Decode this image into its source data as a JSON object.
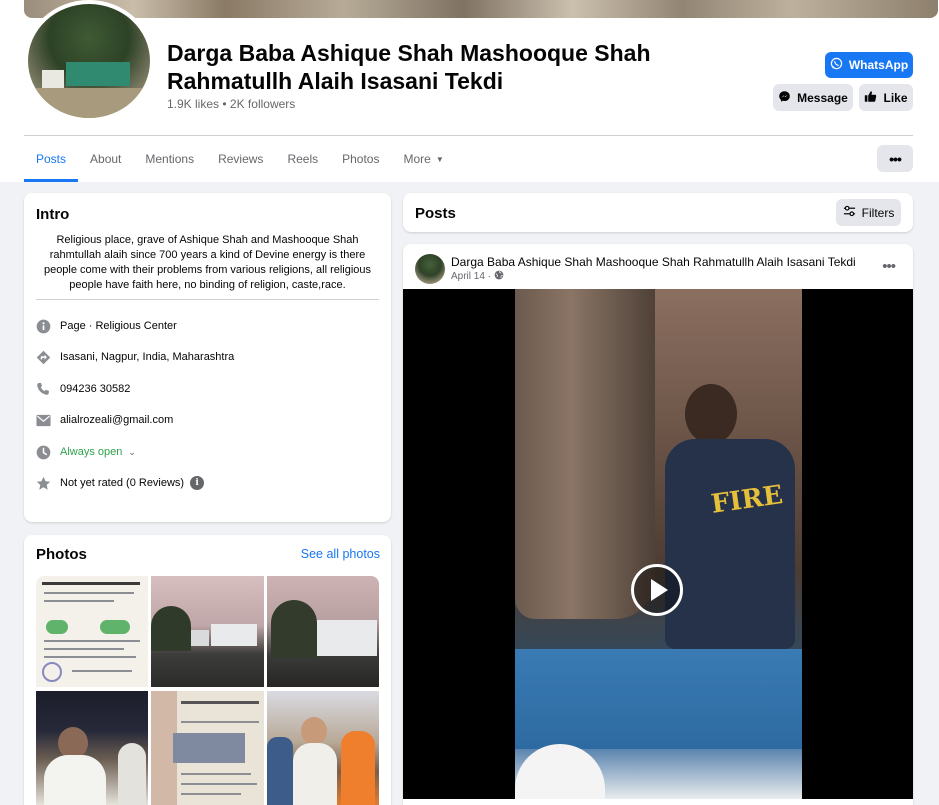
{
  "page": {
    "title": "Darga Baba Ashique Shah Mashooque Shah Rahmatullh Alaih Isasani Tekdi",
    "likes": "1.9K likes",
    "separator": "•",
    "followers": "2K followers"
  },
  "actions": {
    "whatsapp_label": "WhatsApp",
    "message_label": "Message",
    "like_label": "Like",
    "more_icon": "more-horizontal-icon",
    "more_glyph": "•••"
  },
  "tabs": [
    {
      "label": "Posts",
      "active": true
    },
    {
      "label": "About"
    },
    {
      "label": "Mentions"
    },
    {
      "label": "Reviews"
    },
    {
      "label": "Reels"
    },
    {
      "label": "Photos"
    },
    {
      "label": "More"
    }
  ],
  "intro": {
    "title": "Intro",
    "bio": "Religious place, grave of Ashique Shah and Mashooque Shah rahmtullah alaih since 700 years a kind of Devine energy is there people come with their problems from various religions, all religious people have faith here, no binding of religion, caste,race.",
    "details": [
      {
        "icon": "info-icon",
        "text": "Page · Religious Center"
      },
      {
        "icon": "location-arrow-icon",
        "text": "Isasani, Nagpur, India, Maharashtra"
      },
      {
        "icon": "phone-icon",
        "text": "094236 30582"
      },
      {
        "icon": "email-icon",
        "text": "alialrozeali@gmail.com"
      },
      {
        "icon": "clock-icon",
        "text": "Always open"
      },
      {
        "icon": "star-icon",
        "text": "Not yet rated (0 Reviews)"
      }
    ]
  },
  "photos": {
    "title": "Photos",
    "see_all": "See all photos"
  },
  "posts": {
    "title": "Posts",
    "filters_label": "Filters"
  },
  "post": {
    "author": "Darga Baba Ashique Shah Mashooque Shah Rahmatullh Alaih Isasani Tekdi",
    "date": "April 14 ·",
    "menu_glyph": "•••",
    "video_text": "FIRE"
  },
  "colors": {
    "accent": "#1877f2",
    "open_status": "#31a24c",
    "secondary_button": "#e4e6eb",
    "background": "#f0f2f5"
  }
}
